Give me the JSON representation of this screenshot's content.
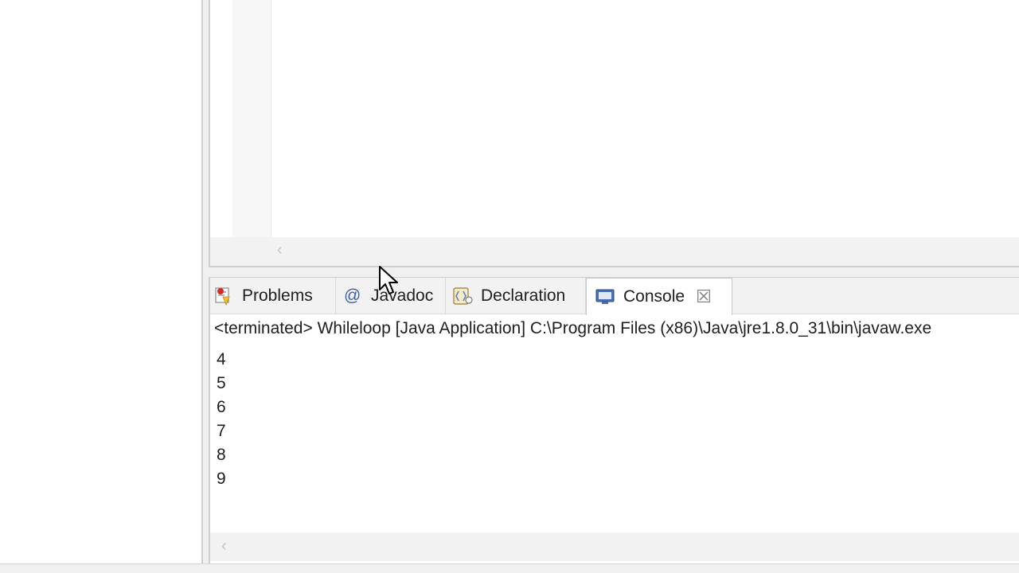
{
  "bottom_view": {
    "tabs": [
      {
        "label": "Problems",
        "icon": "problems-icon",
        "active": false
      },
      {
        "label": "Javadoc",
        "icon": "at-icon",
        "active": false
      },
      {
        "label": "Declaration",
        "icon": "declaration-icon",
        "active": false
      },
      {
        "label": "Console",
        "icon": "console-icon",
        "active": true,
        "close_icon": "close-icon"
      }
    ],
    "javadoc_symbol": "@",
    "close_glyph": "☒",
    "console_status": "<terminated> Whileloop [Java Application] C:\\Program Files (x86)\\Java\\jre1.8.0_31\\bin\\javaw.exe",
    "console_output": [
      "4",
      "5",
      "6",
      "7",
      "8",
      "9"
    ]
  },
  "scroll_arrow_glyph": "‹"
}
